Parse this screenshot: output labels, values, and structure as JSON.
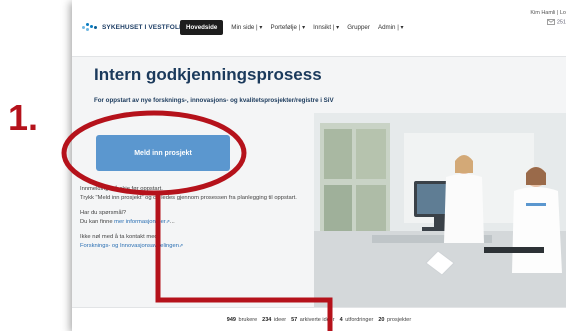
{
  "step_number": "1.",
  "brand": {
    "name": "SYKEHUSET I VESTFOLD"
  },
  "nav": {
    "items": [
      {
        "label": "Hovedside"
      },
      {
        "label": "Min side |",
        "caret": "▾"
      },
      {
        "label": "Portefølje |",
        "caret": "▾"
      },
      {
        "label": "Innsikt |",
        "caret": "▾"
      },
      {
        "label": "Grupper"
      },
      {
        "label": "Admin |",
        "caret": "▾"
      }
    ]
  },
  "user": {
    "name": "Kim Hamli | Lo",
    "mail_count": "251"
  },
  "hero": {
    "title": "Intern godkjenningsprosess",
    "subtitle": "For oppstart av nye forsknings-, innovasjons- og kvalitetsprosjekter/registre i SiV",
    "cta_label": "Meld inn prosjekt",
    "info": {
      "p1_line1": "Innmelding må skje før oppstart.",
      "p1_line2": "Trykk \"Meld inn prosjekt\" og du ledes gjennom prosessen fra planlegging til oppstart.",
      "p2_line1": "Har du spørsmål?",
      "p2_prefix": "Du kan finne ",
      "p2_link": "mer informasjon her",
      "p2_suffix": "...",
      "p3_line1": "Ikke nøl med å ta kontakt med",
      "p3_link": "Forsknings- og Innovasjonsavdelingen"
    }
  },
  "stats": [
    {
      "value": "949",
      "label": "brukere"
    },
    {
      "value": "234",
      "label": "ideer"
    },
    {
      "value": "57",
      "label": "arkiverte ideer"
    },
    {
      "value": "4",
      "label": "utfordringer"
    },
    {
      "value": "20",
      "label": "prosjekter"
    }
  ],
  "colors": {
    "annotation_red": "#b5121b",
    "cta_blue": "#5b97cf",
    "title_navy": "#1b3a5c"
  }
}
